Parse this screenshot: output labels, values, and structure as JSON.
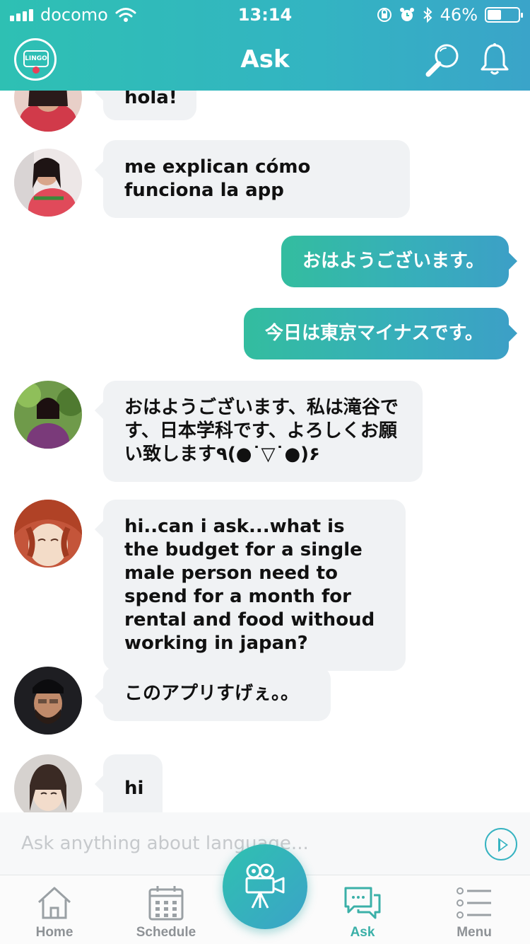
{
  "status_bar": {
    "carrier": "docomo",
    "time": "13:14",
    "battery_percent": "46%",
    "battery_level": 0.46
  },
  "header": {
    "title": "Ask",
    "logo_text": "LINGO"
  },
  "messages": [
    {
      "direction": "in",
      "avatar": "avatar-girl-red-top",
      "text": "hola!"
    },
    {
      "direction": "in",
      "avatar": "avatar-girl-red-top",
      "text": "me explican cómo funciona la app"
    },
    {
      "direction": "out",
      "text": "おはようございます。"
    },
    {
      "direction": "out",
      "text": "今日は東京マイナスです。"
    },
    {
      "direction": "in",
      "avatar": "avatar-woman-outdoors",
      "text": "おはようございます、私は滝谷です、日本学科です、よろしくお願い致します٩(●˙▽˙●)۶"
    },
    {
      "direction": "in",
      "avatar": "avatar-anime",
      "text": "hi..can i ask...what is the budget for a single male person need to spend for a month for rental and food withoud working in japan?"
    },
    {
      "direction": "in",
      "avatar": "avatar-man-beard",
      "text": "このアプリすげぇ。。"
    },
    {
      "direction": "in",
      "avatar": "avatar-girl-smiling",
      "text": "hi"
    }
  ],
  "composer": {
    "placeholder": "Ask anything about language..."
  },
  "tabbar": {
    "home": "Home",
    "schedule": "Schedule",
    "ask": "Ask",
    "menu": "Menu"
  },
  "colors": {
    "accent_start": "#2ec0b3",
    "accent_end": "#3ca0c6",
    "bubble_in": "#f0f2f4",
    "active_tab": "#3bb0a8"
  }
}
